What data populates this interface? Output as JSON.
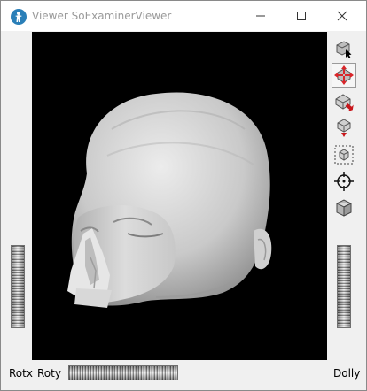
{
  "window": {
    "title": "Viewer SoExaminerViewer"
  },
  "titlebar_buttons": [
    "minimize-icon",
    "maximize-icon",
    "close-icon"
  ],
  "toolbar": {
    "items": [
      {
        "icon": "pick-mode-icon"
      },
      {
        "icon": "view-mode-icon",
        "active": true
      },
      {
        "icon": "home-icon"
      },
      {
        "icon": "set-home-icon"
      },
      {
        "icon": "view-all-icon"
      },
      {
        "icon": "seek-icon"
      },
      {
        "icon": "projection-icon"
      }
    ]
  },
  "thumbwheels": {
    "rotx_label": "Rotx",
    "roty_label": "Roty",
    "dolly_label": "Dolly"
  }
}
